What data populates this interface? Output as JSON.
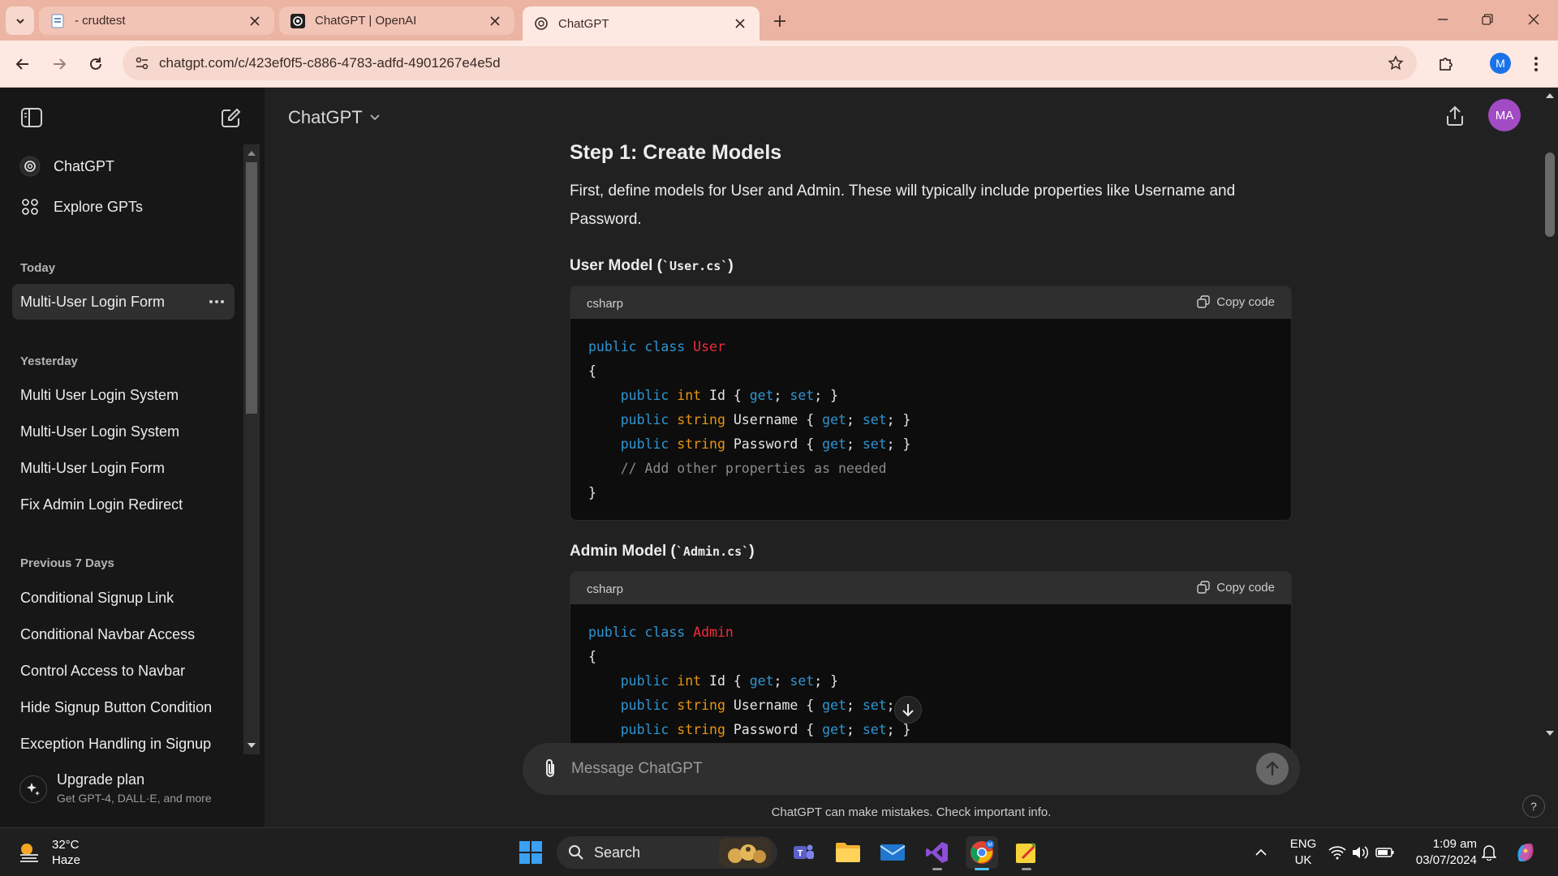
{
  "browser": {
    "tabs": [
      {
        "title": "- crudtest",
        "icon": "document-icon",
        "active": false
      },
      {
        "title": "ChatGPT | OpenAI",
        "icon": "openai-icon",
        "active": false
      },
      {
        "title": "ChatGPT",
        "icon": "openai-icon",
        "active": true
      }
    ],
    "url": "chatgpt.com/c/423ef0f5-c886-4783-adfd-4901267e4e5d",
    "profile_initial": "M",
    "accent": "#ecb4a3"
  },
  "sidebar": {
    "top_links": [
      {
        "label": "ChatGPT",
        "icon": "openai-icon"
      },
      {
        "label": "Explore GPTs",
        "icon": "grid-icon"
      }
    ],
    "sections": [
      {
        "title": "Today",
        "items": [
          "Multi-User Login Form"
        ]
      },
      {
        "title": "Yesterday",
        "items": [
          "Multi User Login System",
          "Multi-User Login System",
          "Multi-User Login Form",
          "Fix Admin Login Redirect"
        ]
      },
      {
        "title": "Previous 7 Days",
        "items": [
          "Conditional Signup Link",
          "Conditional Navbar Access",
          "Control Access to Navbar",
          "Hide Signup Button Condition",
          "Exception Handling in Signup"
        ]
      }
    ],
    "upgrade": {
      "title": "Upgrade plan",
      "subtitle": "Get GPT-4, DALL·E, and more"
    }
  },
  "header": {
    "model": "ChatGPT",
    "avatar_initials": "MA",
    "avatar_color": "#a24bc5"
  },
  "content": {
    "step_title": "Step 1: Create Models",
    "intro": "First, define models for User and Admin. These will typically include properties like Username and Password.",
    "blocks": [
      {
        "heading_prefix": "User Model (",
        "heading_code": "`User.cs`",
        "heading_suffix": ")",
        "lang": "csharp",
        "copy_label": "Copy code",
        "class_name": "User",
        "lines": {
          "kw_public": "public",
          "kw_class": "class",
          "open": "{",
          "close": "}",
          "id_type": "int",
          "id_name": "Id",
          "user_type": "string",
          "user_name": "Username",
          "pass_type": "string",
          "pass_name": "Password",
          "get": "get",
          "set": "set",
          "comment": "// Add other properties as needed"
        }
      },
      {
        "heading_prefix": "Admin Model (",
        "heading_code": "`Admin.cs`",
        "heading_suffix": ")",
        "lang": "csharp",
        "copy_label": "Copy code",
        "class_name": "Admin",
        "lines": {
          "kw_public": "public",
          "kw_class": "class",
          "open": "{",
          "id_type": "int",
          "id_name": "Id",
          "user_type": "string",
          "user_name": "Username",
          "pass_type": "string",
          "pass_name": "Password",
          "get": "get",
          "set": "set"
        }
      }
    ]
  },
  "composer": {
    "placeholder": "Message ChatGPT",
    "disclaimer": "ChatGPT can make mistakes. Check important info.",
    "help": "?"
  },
  "taskbar": {
    "weather": {
      "temp": "32°C",
      "condition": "Haze"
    },
    "search_label": "Search",
    "language": {
      "line1": "ENG",
      "line2": "UK"
    },
    "time": "1:09 am",
    "date": "03/07/2024"
  }
}
